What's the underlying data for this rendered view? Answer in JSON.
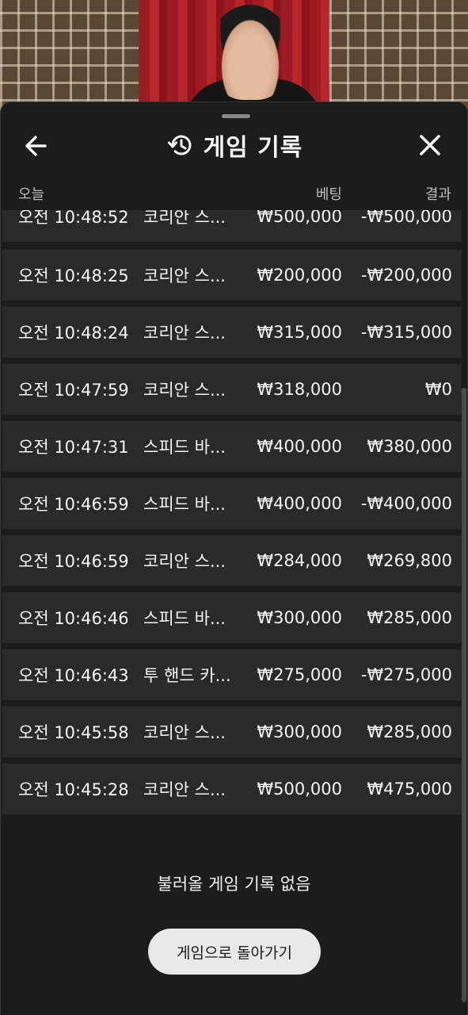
{
  "header": {
    "title": "게임 기록",
    "back_icon": "arrow-left-icon",
    "history_icon": "history-icon",
    "close_icon": "close-icon"
  },
  "columns": {
    "date": "오늘",
    "bet": "베팅",
    "result": "결과"
  },
  "rows": [
    {
      "time": "오전 10:48:52",
      "game": "코리안 스...",
      "bet": "₩500,000",
      "result": "-₩500,000"
    },
    {
      "time": "오전 10:48:25",
      "game": "코리안 스...",
      "bet": "₩200,000",
      "result": "-₩200,000"
    },
    {
      "time": "오전 10:48:24",
      "game": "코리안 스...",
      "bet": "₩315,000",
      "result": "-₩315,000"
    },
    {
      "time": "오전 10:47:59",
      "game": "코리안 스...",
      "bet": "₩318,000",
      "result": "₩0"
    },
    {
      "time": "오전 10:47:31",
      "game": "스피드 바...",
      "bet": "₩400,000",
      "result": "₩380,000"
    },
    {
      "time": "오전 10:46:59",
      "game": "스피드 바...",
      "bet": "₩400,000",
      "result": "-₩400,000"
    },
    {
      "time": "오전 10:46:59",
      "game": "코리안 스...",
      "bet": "₩284,000",
      "result": "₩269,800"
    },
    {
      "time": "오전 10:46:46",
      "game": "스피드 바...",
      "bet": "₩300,000",
      "result": "₩285,000"
    },
    {
      "time": "오전 10:46:43",
      "game": "투 핸드 카...",
      "bet": "₩275,000",
      "result": "-₩275,000"
    },
    {
      "time": "오전 10:45:58",
      "game": "코리안 스...",
      "bet": "₩300,000",
      "result": "₩285,000"
    },
    {
      "time": "오전 10:45:28",
      "game": "코리안 스...",
      "bet": "₩500,000",
      "result": "₩475,000"
    }
  ],
  "empty_message": "불러올 게임 기록 없음",
  "return_button": "게임으로 돌아가기",
  "colors": {
    "sheet_bg": "#1c1c1c",
    "row_bg": "#2a2a2a",
    "button_bg": "#e8e8e8"
  }
}
